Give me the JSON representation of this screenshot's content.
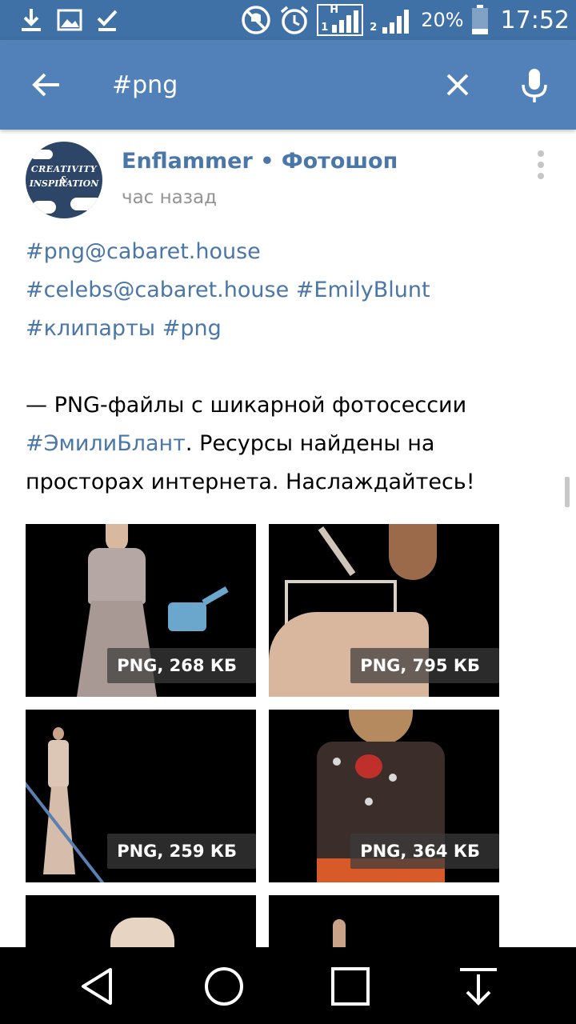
{
  "status_bar": {
    "left_icons": [
      "download-icon",
      "image-icon",
      "check-icon"
    ],
    "right_icons": [
      "do-not-disturb-icon",
      "alarm-icon",
      "signal-sim1-icon",
      "signal-sim2-icon",
      "battery-icon"
    ],
    "sim1_label": "H",
    "sim1_number": "1",
    "sim2_number": "2",
    "battery_percent": "20%",
    "time": "17:52"
  },
  "search_bar": {
    "query": "#png",
    "icons": [
      "back-arrow-icon",
      "clear-icon",
      "microphone-icon"
    ]
  },
  "post": {
    "author": "Enflammer • Фотошоп",
    "time_ago": "час назад",
    "avatar": {
      "line1": "CREATIVITY &",
      "line2": "INSPIRATION"
    },
    "hashtag_lines": [
      "#png@cabaret.house",
      "#celebs@cabaret.house #EmilyBlunt",
      "#клипарты #png"
    ],
    "text": {
      "line1": "— PNG-файлы с шикарной фотосессии",
      "line2_link": "#ЭмилиБлант",
      "line2_rest": ". Ресурсы найдены на",
      "line3": "просторах интернета. Наслаждайтесь!"
    },
    "attachments": [
      {
        "label": "PNG, 268 КБ"
      },
      {
        "label": "PNG, 795 КБ"
      },
      {
        "label": "PNG, 259 КБ"
      },
      {
        "label": "PNG, 364 КБ"
      }
    ]
  },
  "nav_bar": {
    "icons": [
      "back-triangle-icon",
      "home-circle-icon",
      "recents-square-icon",
      "notifications-pull-icon"
    ]
  },
  "colors": {
    "status_bar": "#3f70a6",
    "app_bar": "#5181b8",
    "link": "#4a76a8",
    "meta_text": "#939393",
    "nav_bar": "#000000"
  }
}
